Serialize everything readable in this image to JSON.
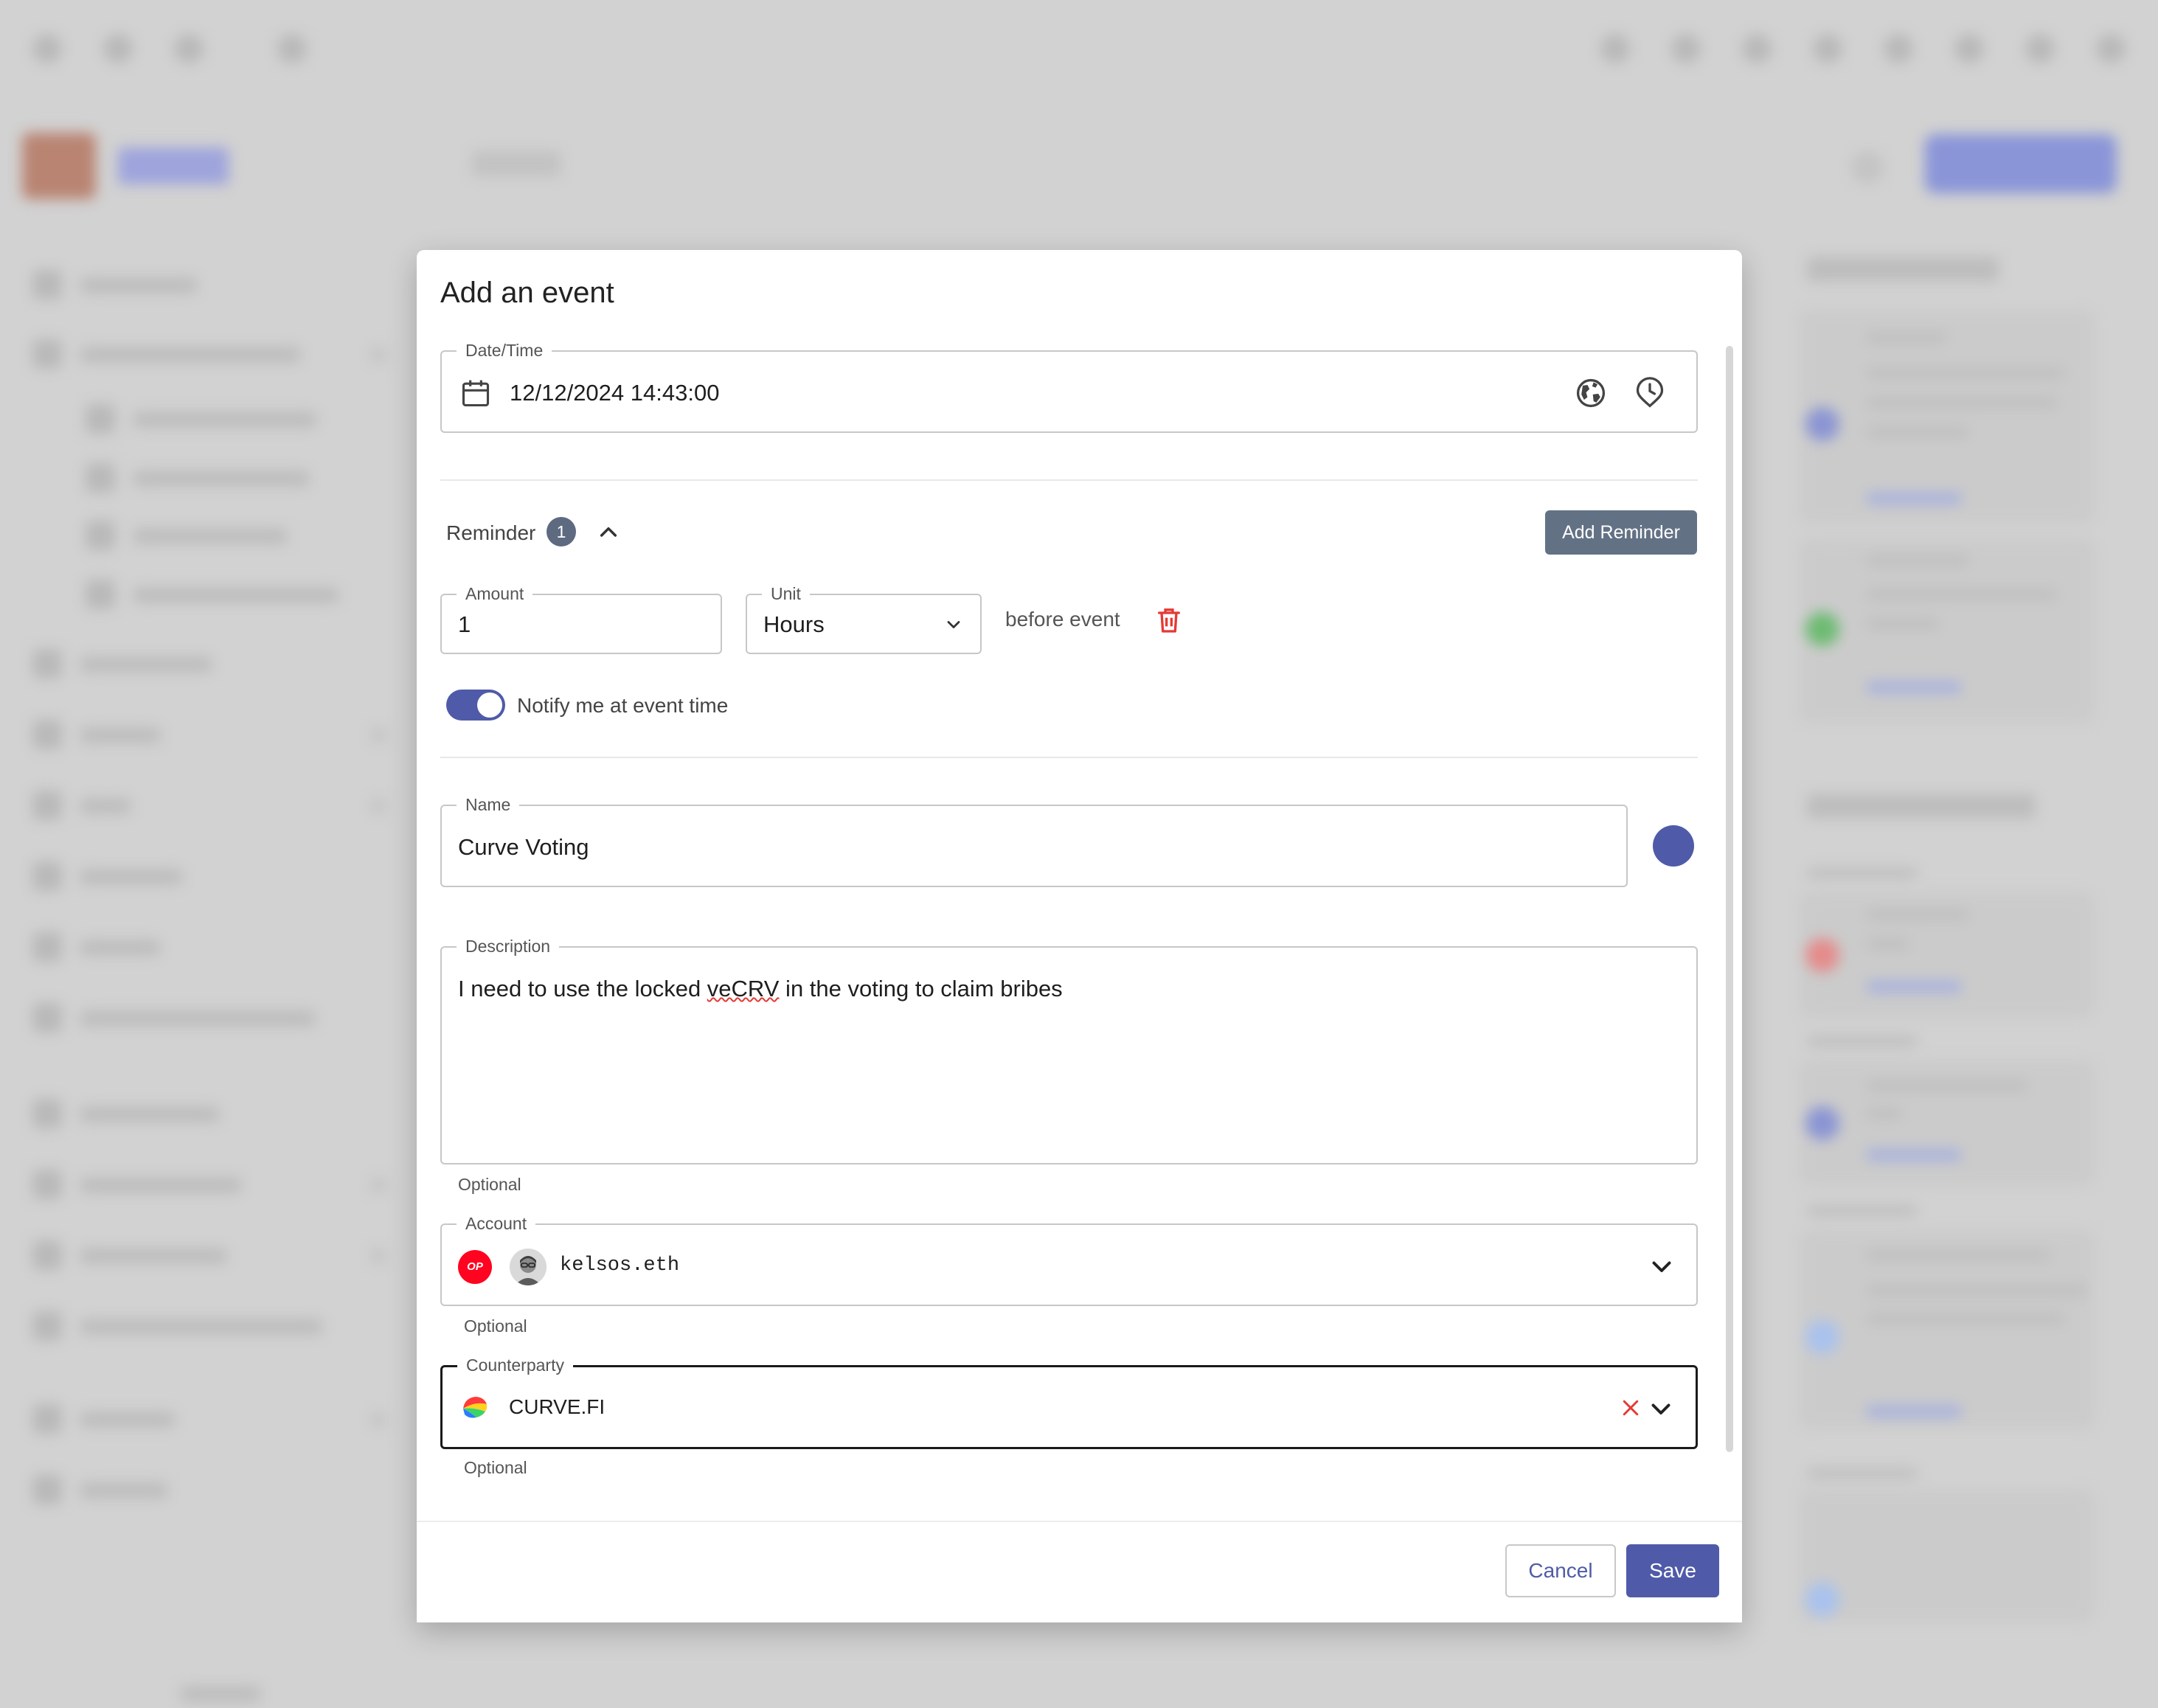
{
  "dialog": {
    "title": "Add an event",
    "date_time": {
      "label": "Date/Time",
      "value": "12/12/2024 14:43:00"
    },
    "reminder": {
      "label": "Reminder",
      "count": "1",
      "add_button": "Add Reminder",
      "amount": {
        "label": "Amount",
        "value": "1"
      },
      "unit": {
        "label": "Unit",
        "value": "Hours"
      },
      "before_text": "before event",
      "notify_label": "Notify me at event time",
      "notify_enabled": true
    },
    "name": {
      "label": "Name",
      "value": "Curve Voting",
      "color": "#4f5ba8"
    },
    "description": {
      "label": "Description",
      "value_before": "I need to use the locked ",
      "value_misspelled": "veCRV",
      "value_after": " in the voting to claim bribes",
      "helper": "Optional"
    },
    "account": {
      "label": "Account",
      "chain_badge": "OP",
      "value": "kelsos.eth",
      "helper": "Optional"
    },
    "counterparty": {
      "label": "Counterparty",
      "value": "CURVE.FI",
      "helper": "Optional"
    },
    "footer": {
      "cancel": "Cancel",
      "save": "Save"
    }
  },
  "colors": {
    "primary": "#4f5ba8",
    "secondary": "#637185",
    "error": "#e53935",
    "op_red": "#ff0420"
  }
}
